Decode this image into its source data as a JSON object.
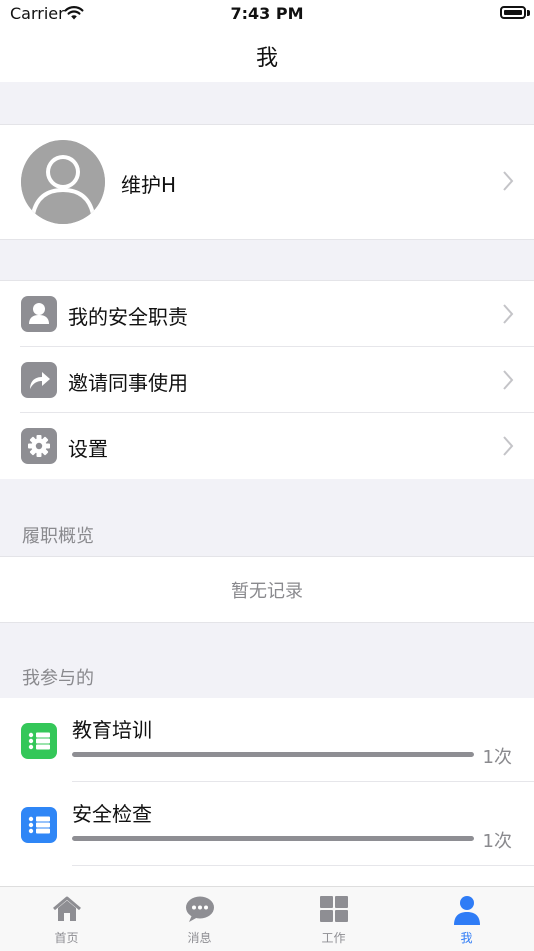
{
  "status_bar": {
    "carrier": "Carrier",
    "time": "7:43 PM"
  },
  "nav": {
    "title": "我"
  },
  "profile": {
    "name": "维护H"
  },
  "menu": {
    "items": [
      {
        "label": "我的安全职责",
        "icon": "person-icon"
      },
      {
        "label": "邀请同事使用",
        "icon": "share-arrow-icon"
      },
      {
        "label": "设置",
        "icon": "gear-icon"
      }
    ]
  },
  "performance": {
    "header": "履职概览",
    "empty_text": "暂无记录"
  },
  "participation": {
    "header": "我参与的",
    "items": [
      {
        "title": "教育培训",
        "count": "1次",
        "progress": 1.0,
        "color": "#34c759",
        "icon": "list-icon"
      },
      {
        "title": "安全检查",
        "count": "1次",
        "progress": 1.0,
        "color": "#2f86f6",
        "icon": "list-icon"
      }
    ]
  },
  "tabs": [
    {
      "label": "首页",
      "icon": "home-icon",
      "active": false
    },
    {
      "label": "消息",
      "icon": "chat-icon",
      "active": false
    },
    {
      "label": "工作",
      "icon": "grid-icon",
      "active": false
    },
    {
      "label": "我",
      "icon": "user-icon",
      "active": true
    }
  ],
  "colors": {
    "accent": "#2f7cf6",
    "icon_gray": "#8e8e93",
    "background": "#f2f2f7"
  }
}
